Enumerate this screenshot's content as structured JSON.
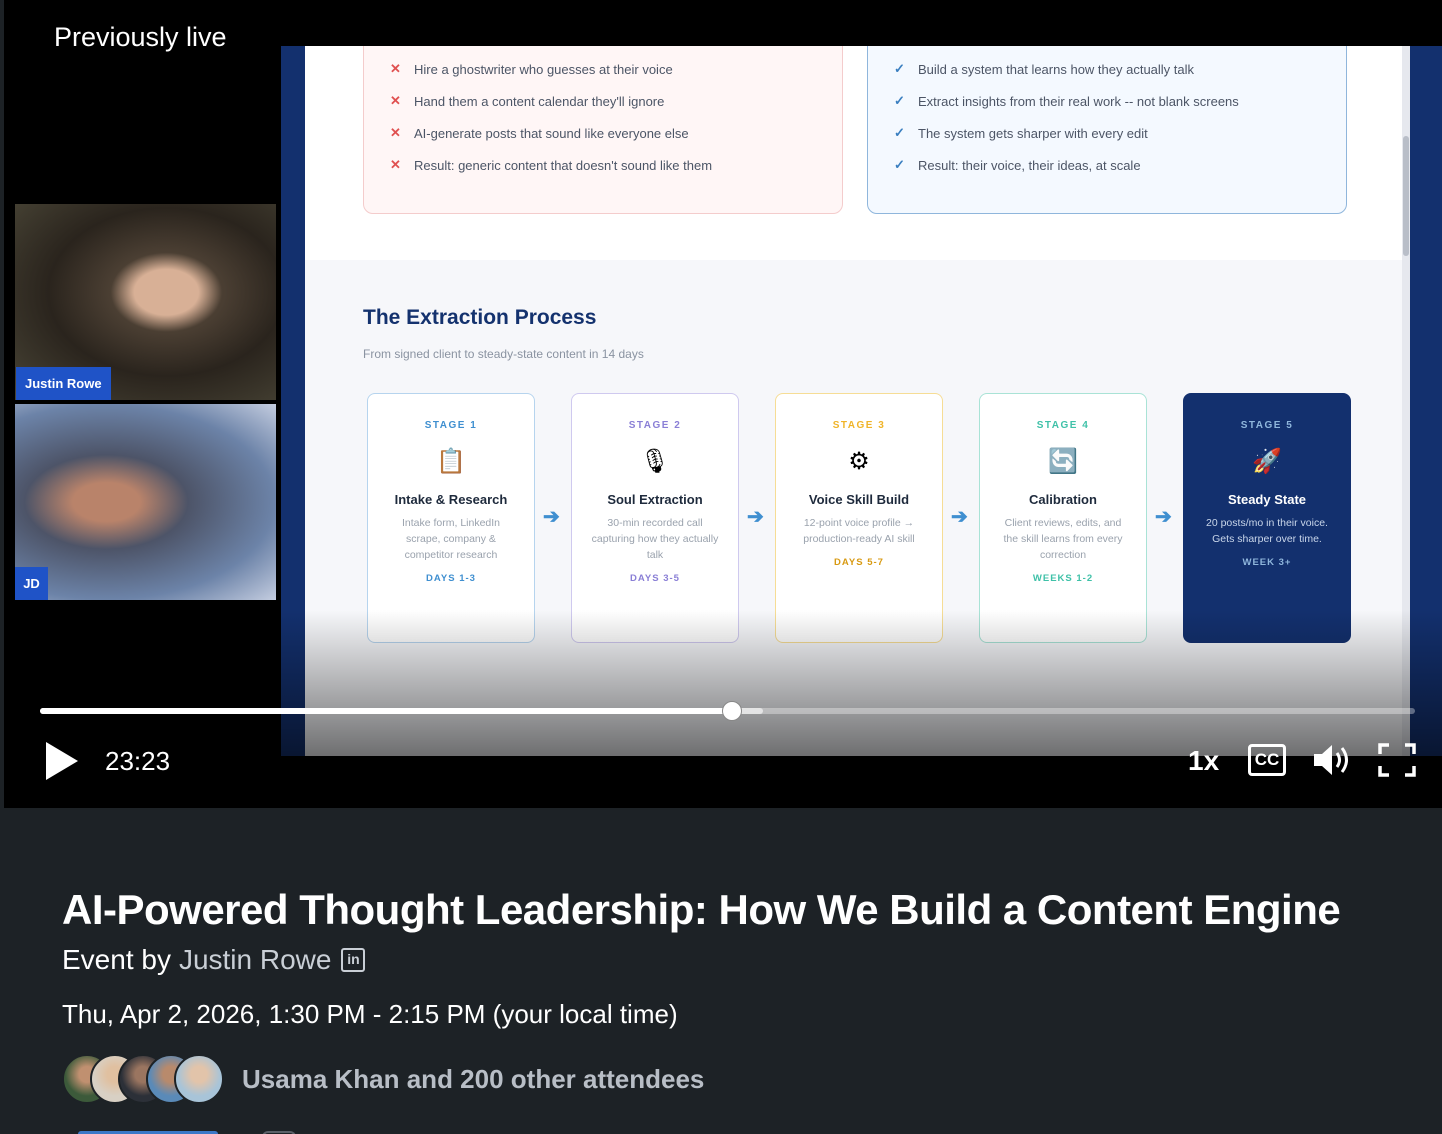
{
  "player": {
    "live_badge": "Previously live",
    "time": "23:23",
    "speed": "1x",
    "cc_label": "CC",
    "progress_fraction": 0.503
  },
  "participants": [
    {
      "name": "Justin Rowe"
    },
    {
      "initials": "JD"
    }
  ],
  "slide": {
    "bad_items": [
      "Hire a ghostwriter who guesses at their voice",
      "Hand them a content calendar they'll ignore",
      "AI-generate posts that sound like everyone else",
      "Result: generic content that doesn't sound like them"
    ],
    "good_items": [
      "Build a system that learns how they actually talk",
      "Extract insights from their real work -- not blank screens",
      "The system gets sharper with every edit",
      "Result: their voice, their ideas, at scale"
    ],
    "process_title": "The Extraction Process",
    "process_subtitle": "From signed client to steady-state content in 14 days",
    "stages": [
      {
        "label": "STAGE 1",
        "name": "Intake & Research",
        "desc": "Intake form, LinkedIn scrape, company & competitor research",
        "days": "DAYS 1-3",
        "icon": "clipboard-icon",
        "glyph": "📋"
      },
      {
        "label": "STAGE 2",
        "name": "Soul Extraction",
        "desc": "30-min recorded call capturing how they actually talk",
        "days": "DAYS 3-5",
        "icon": "microphone-icon",
        "glyph": "🎙"
      },
      {
        "label": "STAGE 3",
        "name": "Voice Skill Build",
        "desc": "12-point voice profile → production-ready AI skill",
        "days": "DAYS 5-7",
        "icon": "gear-icon",
        "glyph": "⚙"
      },
      {
        "label": "STAGE 4",
        "name": "Calibration",
        "desc": "Client reviews, edits, and the skill learns from every correction",
        "days": "WEEKS 1-2",
        "icon": "refresh-icon",
        "glyph": "🔄"
      },
      {
        "label": "STAGE 5",
        "name": "Steady State",
        "desc": "20 posts/mo in their voice. Gets sharper over time.",
        "days": "WEEK 3+",
        "icon": "rocket-icon",
        "glyph": "🚀"
      }
    ],
    "colors": {
      "stage1": "#3f8fd0",
      "stage2": "#8a7fd6",
      "stage3": "#f0b429",
      "stage4": "#3fc1a8",
      "stage5": "#13306e"
    }
  },
  "event": {
    "title": "AI-Powered Thought Leadership: How We Build a Content Engine",
    "by_prefix": "Event by",
    "host": "Justin Rowe",
    "linkedin_icon": "in",
    "datetime": "Thu, Apr 2, 2026, 1:30 PM - 2:15 PM (your local time)",
    "attendees_text": "Usama Khan and 200 other attendees"
  }
}
